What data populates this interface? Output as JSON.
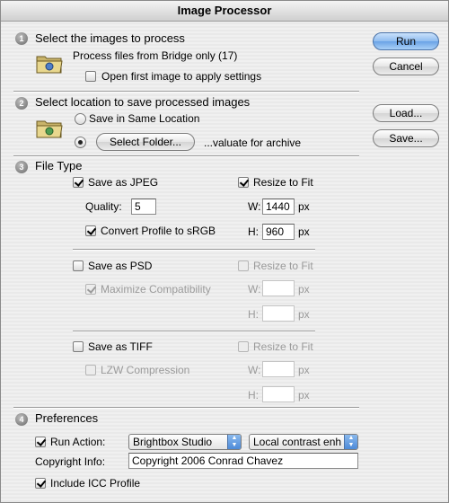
{
  "window": {
    "title": "Image Processor"
  },
  "buttons": {
    "run": "Run",
    "cancel": "Cancel",
    "load": "Load...",
    "save": "Save..."
  },
  "section1": {
    "number": "1",
    "heading": "Select the images to process",
    "source_text": "Process files from Bridge only (17)",
    "open_first_label": "Open first image to apply settings",
    "open_first_checked": false
  },
  "section2": {
    "number": "2",
    "heading": "Select location to save processed images",
    "same_location_label": "Save in Same Location",
    "select_folder_label": "Select Folder...",
    "selected_option": "select_folder",
    "folder_path": "...valuate for archive"
  },
  "section3": {
    "number": "3",
    "heading": "File Type",
    "jpeg": {
      "label": "Save as JPEG",
      "checked": true,
      "quality_label": "Quality:",
      "quality_value": "5",
      "convert_label": "Convert Profile to sRGB",
      "convert_checked": true,
      "resize_label": "Resize to Fit",
      "resize_checked": true,
      "w_label": "W:",
      "w_value": "1440",
      "h_label": "H:",
      "h_value": "960",
      "unit": "px"
    },
    "psd": {
      "label": "Save as PSD",
      "checked": false,
      "maximize_label": "Maximize Compatibility",
      "maximize_checked": true,
      "resize_label": "Resize to Fit",
      "resize_checked": false,
      "w_label": "W:",
      "w_value": "",
      "h_label": "H:",
      "h_value": "",
      "unit": "px"
    },
    "tiff": {
      "label": "Save as TIFF",
      "checked": false,
      "lzw_label": "LZW Compression",
      "lzw_checked": false,
      "resize_label": "Resize to Fit",
      "resize_checked": false,
      "w_label": "W:",
      "w_value": "",
      "h_label": "H:",
      "h_value": "",
      "unit": "px"
    }
  },
  "section4": {
    "number": "4",
    "heading": "Preferences",
    "run_action_label": "Run Action:",
    "run_action_checked": true,
    "action_set": "Brightbox Studio",
    "action_name": "Local contrast enh",
    "copyright_label": "Copyright Info:",
    "copyright_value": "Copyright 2006 Conrad Chavez",
    "icc_label": "Include ICC Profile",
    "icc_checked": true
  },
  "colors": {
    "default_button": "#6aa2e6",
    "disabled_text": "#9a9a9a"
  },
  "icons": {
    "folder": "folder-icon",
    "step": "step-number-icon"
  }
}
